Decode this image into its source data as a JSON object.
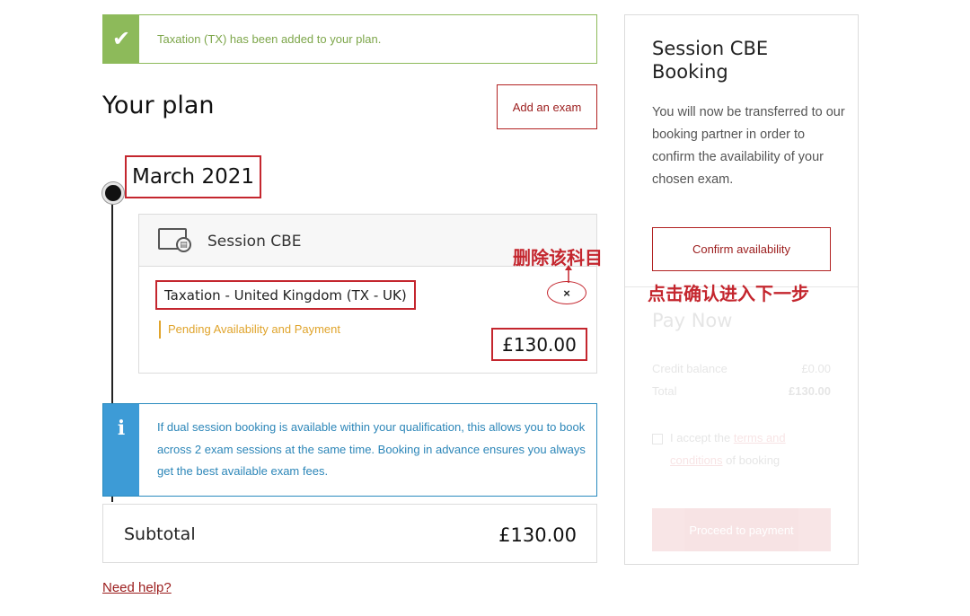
{
  "banner": {
    "message": "Taxation (TX) has been added to your plan."
  },
  "plan": {
    "title": "Your plan",
    "add_exam_label": "Add an exam",
    "month": "March 2021",
    "session": {
      "label": "Session CBE",
      "exam_name": "Taxation - United Kingdom (TX - UK)",
      "status": "Pending Availability and Payment",
      "price": "£130.00",
      "remove_label": "×"
    },
    "info": "If dual session booking is available within your qualification, this allows you to book across 2 exam sessions at the same time. Booking in advance ensures you always get the best available exam fees.",
    "subtotal_label": "Subtotal",
    "subtotal_value": "£130.00",
    "help_link": "Need help?"
  },
  "annotations": {
    "delete": "删除该科目",
    "confirm": "点击确认进入下一步"
  },
  "panel": {
    "title": "Session CBE Booking",
    "text": "You will now be transferred to our booking partner in order to confirm the availability of your chosen exam.",
    "confirm_label": "Confirm availability",
    "pay_now": "Pay Now",
    "credit_label": "Credit balance",
    "credit_value": "£0.00",
    "total_label": "Total",
    "total_value": "£130.00",
    "terms_prefix": "I accept the ",
    "terms_link": "terms and conditions",
    "terms_suffix": " of booking",
    "proceed_label": "Proceed to payment"
  },
  "colors": {
    "brand_red": "#c4262e",
    "success_green": "#8dba5a",
    "info_blue": "#3d9bd6",
    "pending_amber": "#e0a42c"
  },
  "icons": [
    "check-icon",
    "monitor-icon",
    "info-icon",
    "close-icon"
  ]
}
